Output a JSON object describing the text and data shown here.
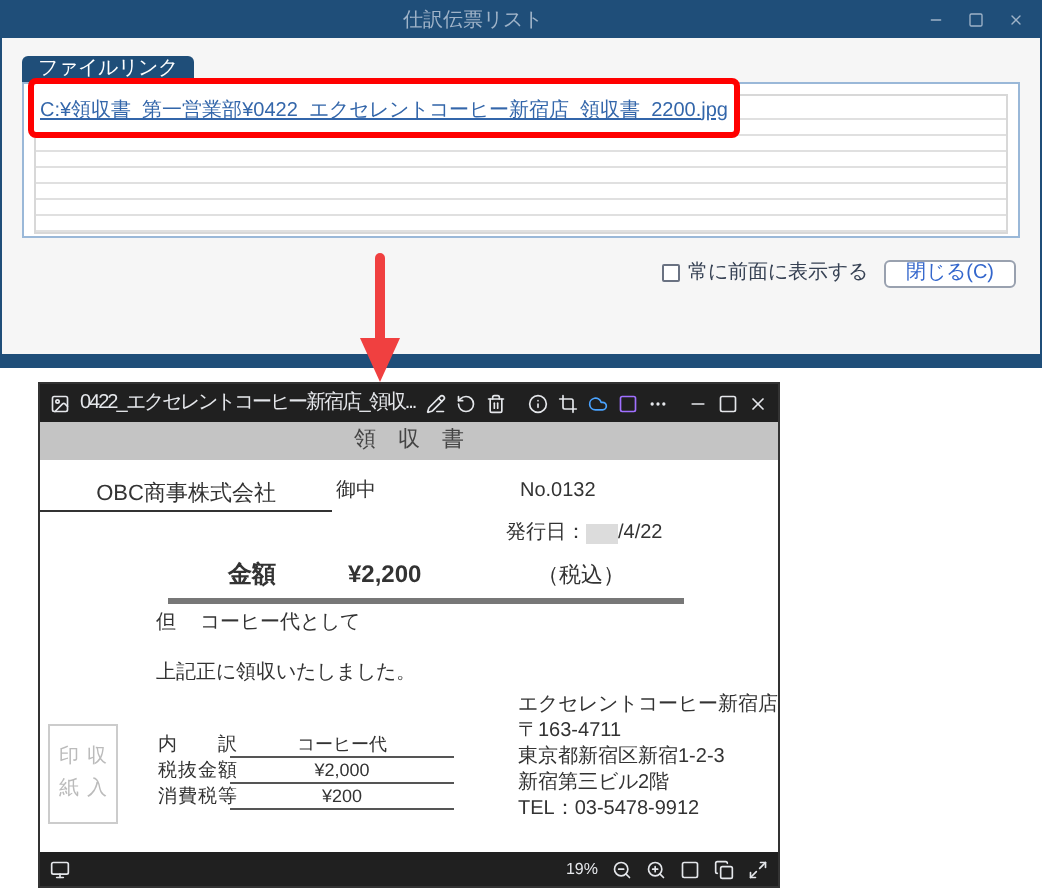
{
  "dialog": {
    "title": "仕訳伝票リスト",
    "tab": {
      "label": "ファイルリンク",
      "selected": true
    },
    "file_links": [
      "C:¥領収書_第一営業部¥0422_エクセレントコーヒー新宿店_領収書_2200.jpg"
    ],
    "always_on_top": {
      "label": "常に前面に表示する",
      "checked": false
    },
    "close_button": "閉じる(C)"
  },
  "viewer": {
    "filename": "0422_エクセレントコーヒー新宿店_領収...",
    "zoom": "19%"
  },
  "receipt": {
    "title": "領　収　書",
    "recipient": "OBC商事株式会社",
    "honorific": "御中",
    "number": "No.0132",
    "issue_date_label": "発行日：",
    "issue_date": "/4/22",
    "amount_label": "金額",
    "amount": "¥2,200",
    "tax_note": "（税込）",
    "purpose_prefix": "但",
    "purpose": "コーヒー代として",
    "received_text": "上記正に領収いたしました。",
    "stamp_columns": [
      "印紙",
      "収入"
    ],
    "breakdown": [
      {
        "label": "内　　訳",
        "value": "コーヒー代"
      },
      {
        "label": "税抜金額",
        "value": "¥2,000"
      },
      {
        "label": "消費税等",
        "value": "¥200"
      }
    ],
    "issuer": [
      "エクセレントコーヒー新宿店",
      "〒163-4711",
      "東京都新宿区新宿1-2-3",
      "新宿第三ビル2階",
      "TEL：03-5478-9912"
    ]
  }
}
